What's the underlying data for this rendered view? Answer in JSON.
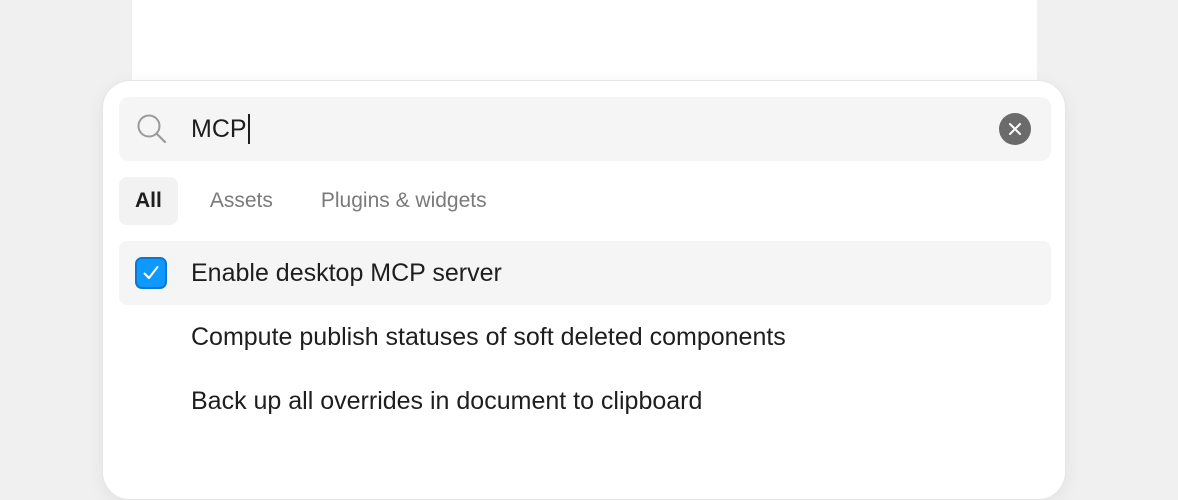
{
  "search": {
    "query": "MCP",
    "icon": "search-icon",
    "clear_icon": "close-icon"
  },
  "tabs": [
    {
      "label": "All",
      "active": true
    },
    {
      "label": "Assets",
      "active": false
    },
    {
      "label": "Plugins & widgets",
      "active": false
    }
  ],
  "results": [
    {
      "label": "Enable desktop MCP server",
      "checked": true,
      "selected": true
    },
    {
      "label": "Compute publish statuses of soft deleted components",
      "selected": false
    },
    {
      "label": "Back up all overrides in document to clipboard",
      "selected": false
    }
  ],
  "colors": {
    "accent": "#0d99ff",
    "selected_row_bg": "#f5f5f5",
    "clear_button": "#6b6b6b"
  }
}
